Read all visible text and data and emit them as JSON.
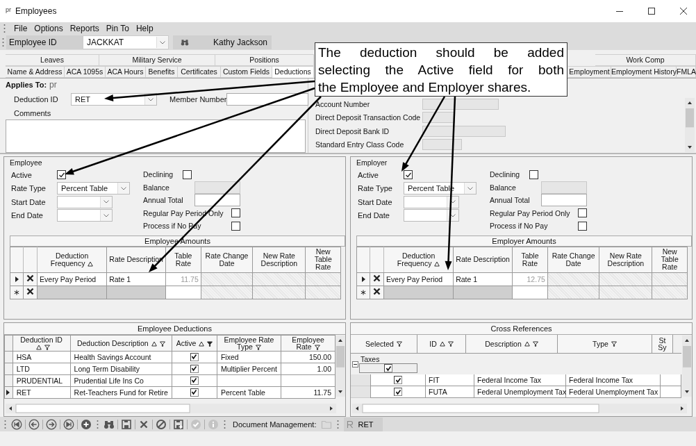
{
  "window": {
    "app_icon": "pr",
    "title": "Employees"
  },
  "menu": [
    {
      "label": "File"
    },
    {
      "label": "Options"
    },
    {
      "label": "Reports"
    },
    {
      "label": "Pin To"
    },
    {
      "label": "Help"
    }
  ],
  "employee_bar": {
    "label": "Employee ID",
    "value": "JACKKAT",
    "name": "Kathy Jackson"
  },
  "tabs_row_1": [
    {
      "label": "Leaves",
      "selected": false
    },
    {
      "label": "Military Service",
      "selected": false
    },
    {
      "label": "Positions",
      "selected": false
    },
    {
      "label": "Work Comp",
      "selected": false
    }
  ],
  "tabs_row_2": [
    {
      "label": "Name & Address",
      "selected": false
    },
    {
      "label": "ACA 1095s",
      "selected": false
    },
    {
      "label": "ACA Hours",
      "selected": false
    },
    {
      "label": "Benefits",
      "selected": false
    },
    {
      "label": "Certificates",
      "selected": false
    },
    {
      "label": "Custom Fields",
      "selected": false
    },
    {
      "label": "Deductions",
      "selected": true
    },
    {
      "label": "Employment",
      "selected": false
    },
    {
      "label": "Employment History",
      "selected": false
    },
    {
      "label": "FMLA",
      "selected": false
    }
  ],
  "applies_to": {
    "label": "Applies To:",
    "value": "pr"
  },
  "deduction_id": {
    "label": "Deduction ID",
    "value": "RET"
  },
  "member_number": {
    "label": "Member Number"
  },
  "comments": {
    "label": "Comments"
  },
  "bank_fields": [
    {
      "label": "Account Number",
      "disabled": true
    },
    {
      "label": "Direct Deposit Transaction Code",
      "disabled": true
    },
    {
      "label": "Direct Deposit Bank ID",
      "disabled": true
    },
    {
      "label": "Standard Entry Class Code",
      "disabled": true
    }
  ],
  "employee": {
    "title": "Employee",
    "left_fields": [
      {
        "kind": "checkbox",
        "label": "Active",
        "checked": true
      },
      {
        "kind": "dropdown",
        "label": "Rate Type",
        "value": "Percent Table"
      },
      {
        "kind": "dropdown",
        "label": "Start Date"
      },
      {
        "kind": "dropdown",
        "label": "End Date"
      }
    ],
    "right_fields": [
      {
        "kind": "checkbox",
        "label": "Declining",
        "checked": false
      },
      {
        "kind": "text",
        "label": "Balance",
        "disabled": true
      },
      {
        "kind": "text",
        "label": "Annual Total",
        "disabled": false
      },
      {
        "kind": "checkbox",
        "label": "Regular Pay Period Only",
        "checked": false
      },
      {
        "kind": "checkbox",
        "label": "Process if No Pay",
        "checked": false
      }
    ],
    "amounts": {
      "title": "Employee Amounts",
      "columns": [
        {
          "label": "Deduction Frequency",
          "sortable": true,
          "readonly": false,
          "disabled": false
        },
        {
          "label": "Rate Description",
          "sortable": false,
          "readonly": false,
          "disabled": false
        },
        {
          "label": "Table Rate",
          "sortable": false,
          "readonly": true,
          "disabled": false
        },
        {
          "label": "Rate Change Date",
          "sortable": false,
          "readonly": false,
          "disabled": true
        },
        {
          "label": "New Rate Description",
          "sortable": false,
          "readonly": false,
          "disabled": true
        },
        {
          "label": "New Table Rate",
          "sortable": false,
          "readonly": false,
          "disabled": true
        }
      ],
      "rows": [
        {
          "kind": "record",
          "current": true,
          "cells": [
            "Every Pay Period",
            "Rate 1",
            "11.75"
          ]
        },
        {
          "kind": "new",
          "current": false
        }
      ]
    }
  },
  "employer": {
    "title": "Employer",
    "left_fields": [
      {
        "kind": "checkbox",
        "label": "Active",
        "checked": true
      },
      {
        "kind": "dropdown",
        "label": "Rate Type",
        "value": "Percent Table"
      },
      {
        "kind": "dropdown",
        "label": "Start Date"
      },
      {
        "kind": "dropdown",
        "label": "End Date"
      }
    ],
    "right_fields": [
      {
        "kind": "checkbox",
        "label": "Declining",
        "checked": false
      },
      {
        "kind": "text",
        "label": "Balance",
        "disabled": true
      },
      {
        "kind": "text",
        "label": "Annual Total",
        "disabled": false
      },
      {
        "kind": "checkbox",
        "label": "Regular Pay Period Only",
        "checked": false
      },
      {
        "kind": "checkbox",
        "label": "Process if No Pay",
        "checked": false
      }
    ],
    "amounts": {
      "title": "Employer Amounts",
      "columns": [
        {
          "label": "Deduction Frequency",
          "sortable": true,
          "readonly": false,
          "disabled": false
        },
        {
          "label": "Rate Description",
          "sortable": false,
          "readonly": false,
          "disabled": false
        },
        {
          "label": "Table Rate",
          "sortable": false,
          "readonly": true,
          "disabled": false
        },
        {
          "label": "Rate Change Date",
          "sortable": false,
          "readonly": false,
          "disabled": true
        },
        {
          "label": "New Rate Description",
          "sortable": false,
          "readonly": false,
          "disabled": true
        },
        {
          "label": "New Table Rate",
          "sortable": false,
          "readonly": false,
          "disabled": true
        }
      ],
      "rows": [
        {
          "kind": "record",
          "current": true,
          "cells": [
            "Every Pay Period",
            "Rate 1",
            "12.75"
          ]
        },
        {
          "kind": "new",
          "current": false
        }
      ]
    }
  },
  "deductions_grid": {
    "title": "Employee Deductions",
    "columns": [
      {
        "label": "Deduction ID",
        "sortable": true,
        "filtered": false
      },
      {
        "label": "Deduction Description",
        "sortable": true,
        "filtered": false
      },
      {
        "label": "Active",
        "sortable": true,
        "filtered": true
      },
      {
        "label": "Employee Rate Type",
        "sortable": false,
        "filtered": false
      },
      {
        "label": "Employee Rate",
        "sortable": false,
        "filtered": false
      }
    ],
    "rows": [
      {
        "id": "HSA",
        "description": "Health Savings Account",
        "active": true,
        "rate_type": "Fixed",
        "rate": "150.00",
        "current": false
      },
      {
        "id": "LTD",
        "description": "Long Term Disability",
        "active": true,
        "rate_type": "Multiplier Percent",
        "rate": "1.00",
        "current": false
      },
      {
        "id": "PRUDENTIAL",
        "description": "Prudential Life Ins Co",
        "active": true,
        "current": false
      },
      {
        "id": "RET",
        "description": "Ret-Teachers Fund for Retire",
        "active": true,
        "rate_type": "Percent Table",
        "rate": "11.75",
        "current": true
      }
    ]
  },
  "cross_references": {
    "title": "Cross References",
    "columns": [
      {
        "label": "Selected",
        "sortable": false
      },
      {
        "label": "ID",
        "sortable": true
      },
      {
        "label": "Description",
        "sortable": true
      },
      {
        "label": "Type",
        "sortable": false
      },
      {
        "label": "St Sy",
        "sortable": false
      }
    ],
    "groups": [
      {
        "label": "Taxes",
        "expanded": true,
        "checked": true,
        "rows": [
          {
            "checked": true,
            "id": "FIT",
            "description": "Federal Income Tax",
            "type": "Federal Income Tax"
          },
          {
            "checked": true,
            "id": "FUTA",
            "description": "Federal Unemployment Tax",
            "type": "Federal Unemployment Tax"
          }
        ]
      }
    ]
  },
  "toolbar": {
    "groups": [
      {
        "buttons": [
          {
            "kind": "first",
            "disabled": false
          },
          {
            "kind": "previous",
            "disabled": false
          },
          {
            "kind": "next",
            "disabled": false
          },
          {
            "kind": "last",
            "disabled": false
          },
          {
            "kind": "add",
            "disabled": false
          }
        ]
      },
      {
        "buttons": [
          {
            "kind": "find",
            "disabled": false
          },
          {
            "kind": "save",
            "disabled": false
          },
          {
            "kind": "delete",
            "disabled": false
          },
          {
            "kind": "cancel",
            "disabled": false
          },
          {
            "kind": "save_new",
            "disabled": false
          },
          {
            "kind": "confirm",
            "disabled": true
          },
          {
            "kind": "info",
            "disabled": true
          }
        ]
      }
    ],
    "doc_label": "Document Management:",
    "record": "RET"
  },
  "callout": {
    "lines": [
      "The deduction should be added",
      "selecting the Active field for both",
      "the Employee and Employer shares."
    ]
  }
}
